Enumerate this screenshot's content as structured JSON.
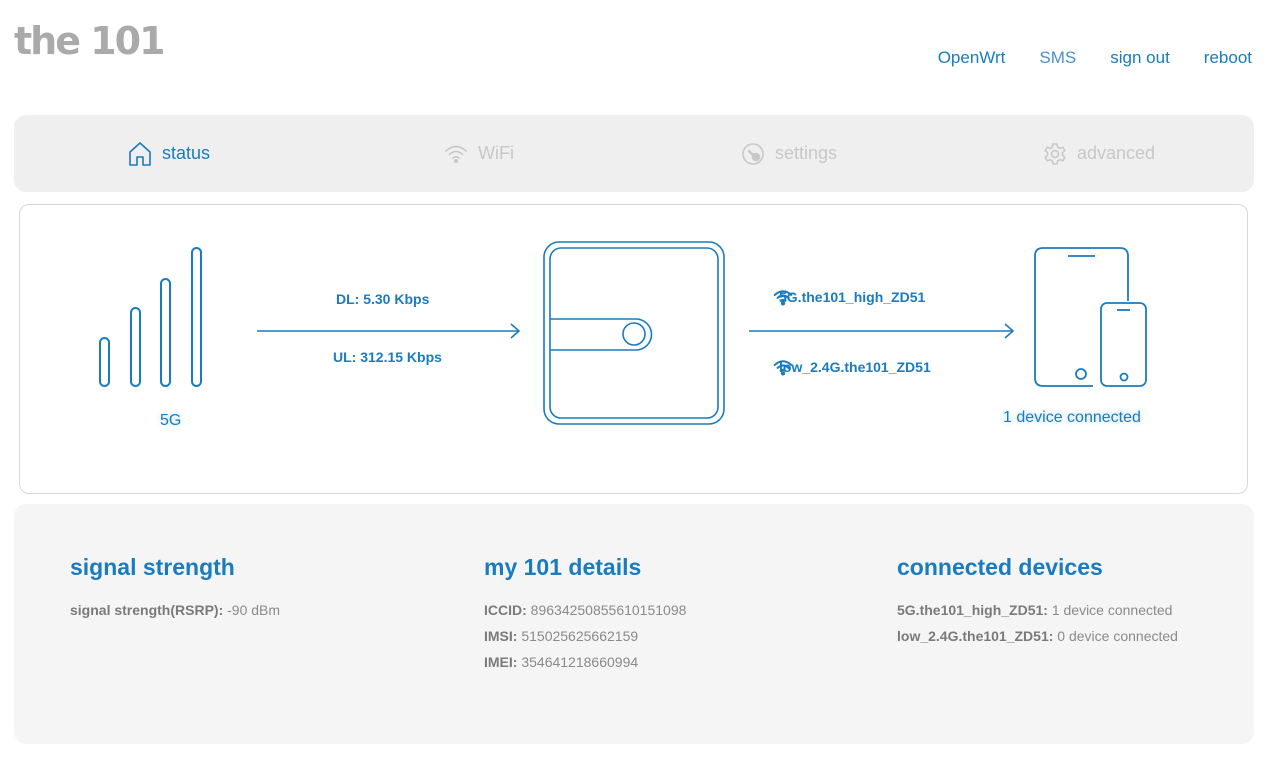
{
  "brand": {
    "logo_text": "the 101"
  },
  "topnav": {
    "items": [
      "OpenWrt",
      "SMS",
      "sign out",
      "reboot"
    ]
  },
  "tabs": [
    {
      "label": "status",
      "icon": "home-icon",
      "active": true
    },
    {
      "label": "WiFi",
      "icon": "wifi-icon",
      "active": false
    },
    {
      "label": "settings",
      "icon": "settings-dial-icon",
      "active": false
    },
    {
      "label": "advanced",
      "icon": "gear-icon",
      "active": false
    }
  ],
  "diagram": {
    "network_type": "5G",
    "download": "DL: 5.30 Kbps",
    "upload": "UL: 312.15 Kbps",
    "ssids": [
      "5G.the101_high_ZD51",
      "low_2.4G.the101_ZD51"
    ],
    "devices_connected": "1 device connected"
  },
  "signal": {
    "title": "signal strength",
    "rsrp_label": "signal strength(RSRP):",
    "rsrp_value": "-90 dBm"
  },
  "details": {
    "title": "my 101 details",
    "rows": [
      {
        "label": "ICCID:",
        "value": "89634250855610151098"
      },
      {
        "label": "IMSI:",
        "value": "515025625662159"
      },
      {
        "label": "IMEI:",
        "value": "354641218660994"
      }
    ]
  },
  "connected": {
    "title": "connected devices",
    "rows": [
      {
        "label": "5G.the101_high_ZD51:",
        "value": "1 device connected"
      },
      {
        "label": "low_2.4G.the101_ZD51:",
        "value": "0 device connected"
      }
    ]
  },
  "colors": {
    "accent": "#1a7bbf",
    "inactive": "#c8c8c8",
    "panel": "#f5f5f5"
  }
}
